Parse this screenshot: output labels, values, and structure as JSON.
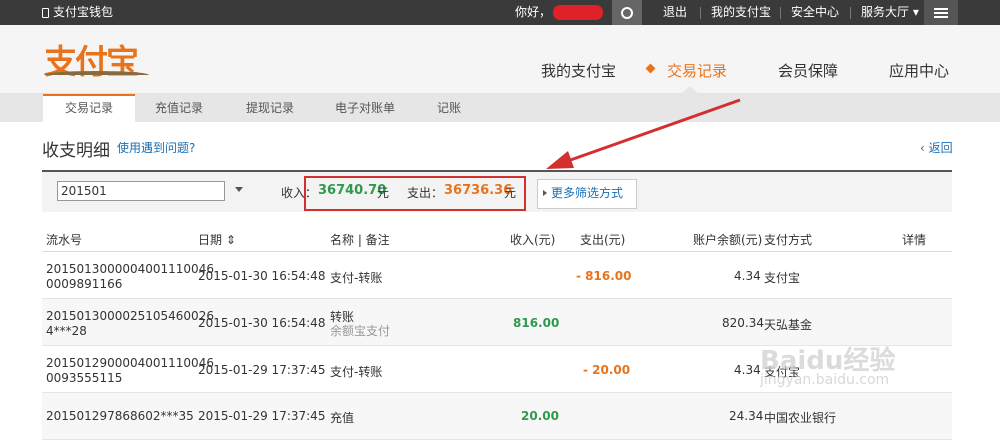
{
  "topbar": {
    "brand": "支付宝钱包",
    "greeting": "你好，",
    "links": [
      "退出",
      "我的支付宝",
      "安全中心",
      "服务大厅"
    ]
  },
  "header": {
    "logo": "支付宝",
    "nav": [
      "我的支付宝",
      "交易记录",
      "会员保障",
      "应用中心"
    ],
    "active_nav": "交易记录"
  },
  "subnav": [
    "交易记录",
    "充值记录",
    "提现记录",
    "电子对账单",
    "记账"
  ],
  "page": {
    "title": "收支明细",
    "help": "使用遇到问题?",
    "back": "返回"
  },
  "filter": {
    "month_value": "201501",
    "income_label": "收入：",
    "income_value": "36740.70",
    "income_unit": "元",
    "expense_label": "支出：",
    "expense_value": "36736.36",
    "expense_unit": "元",
    "more_button": "更多筛选方式"
  },
  "table": {
    "headers": [
      "流水号",
      "日期",
      "名称 | 备注",
      "收入(元)",
      "支出(元)",
      "账户余额(元)",
      "支付方式",
      "详情"
    ],
    "rows": [
      {
        "serial1": "2015013000004001110046",
        "serial2": "0009891166",
        "date": "2015-01-30 16:54:48",
        "name": "支付-转账",
        "note": "",
        "income": "",
        "expense": "- 816.00",
        "balance": "4.34",
        "method": "支付宝"
      },
      {
        "serial1": "2015013000025105460026",
        "serial2": "4***28",
        "date": "2015-01-30 16:54:48",
        "name": "转账",
        "note": "余额宝支付",
        "income": "816.00",
        "expense": "",
        "balance": "820.34",
        "method": "天弘基金"
      },
      {
        "serial1": "2015012900004001110046",
        "serial2": "0093555115",
        "date": "2015-01-29 17:37:45",
        "name": "支付-转账",
        "note": "",
        "income": "",
        "expense": "- 20.00",
        "balance": "4.34",
        "method": "支付宝"
      },
      {
        "serial1": "201501297868602***35",
        "serial2": "",
        "date": "2015-01-29 17:37:45",
        "name": "充值",
        "note": "",
        "income": "20.00",
        "expense": "",
        "balance": "24.34",
        "method": "中国农业银行"
      }
    ]
  },
  "watermark": {
    "main": "Baidu经验",
    "sub": "jingyan.baidu.com"
  },
  "colors": {
    "accent": "#e8731b",
    "income": "#2e9a4e",
    "link": "#1a6fb5",
    "annotation": "#d32f2f"
  }
}
